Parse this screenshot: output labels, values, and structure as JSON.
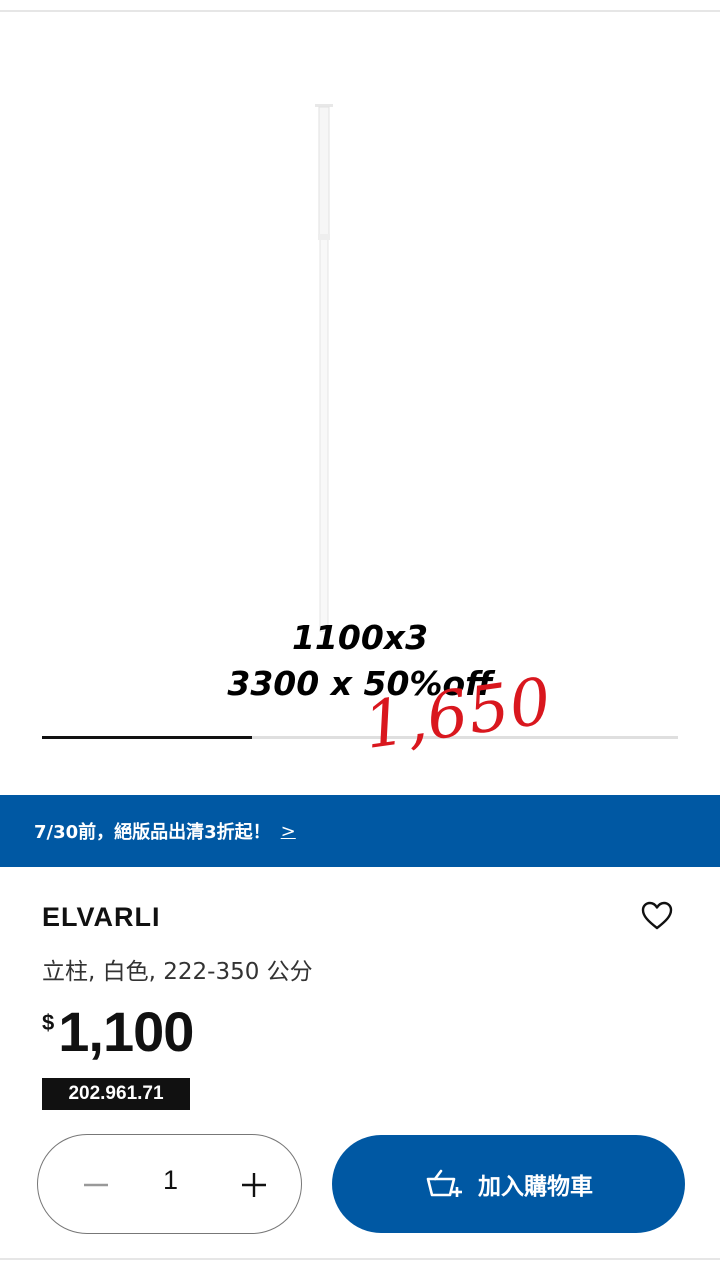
{
  "image_overlay": {
    "line1": "1100x3",
    "line2": "3300 x 50%off",
    "handwritten_price": "1,650",
    "handwritten_color": "#d9171e"
  },
  "carousel": {
    "progress": 0.33
  },
  "promo": {
    "text": "7/30前，絕版品出清3折起！",
    "arrow": ">",
    "background": "#0058a3"
  },
  "product": {
    "name": "ELVARLI",
    "description": "立柱, 白色, 222-350 公分",
    "currency": "$",
    "price": "1,100",
    "article_number": "202.961.71",
    "favorite_icon": "heart-outline-icon"
  },
  "quantity": {
    "value": "1"
  },
  "add_to_cart": {
    "label": "加入購物車",
    "icon": "cart-plus-icon",
    "background": "#0058a3"
  }
}
